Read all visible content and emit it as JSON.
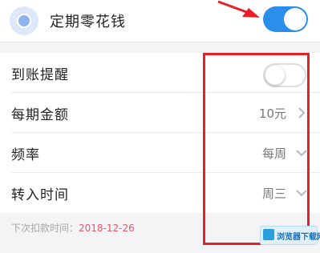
{
  "header": {
    "title": "定期零花钱",
    "toggle_on": true,
    "icon": "wallet-app-icon"
  },
  "settings": [
    {
      "label": "到账提醒",
      "type": "toggle",
      "on": false
    },
    {
      "label": "每期金额",
      "value": "10元",
      "control": "chevron-right"
    },
    {
      "label": "频率",
      "value": "每周",
      "control": "chevron-down"
    },
    {
      "label": "转入时间",
      "value": "周三",
      "control": "chevron-down"
    }
  ],
  "footer": {
    "label": "下次扣款时间：",
    "date": "2018-12-26"
  },
  "watermark": {
    "text": "浏览器下载网"
  },
  "colors": {
    "accent": "#2a8eea",
    "annotation_red": "#e5202a",
    "date_color": "#e05a6a"
  }
}
